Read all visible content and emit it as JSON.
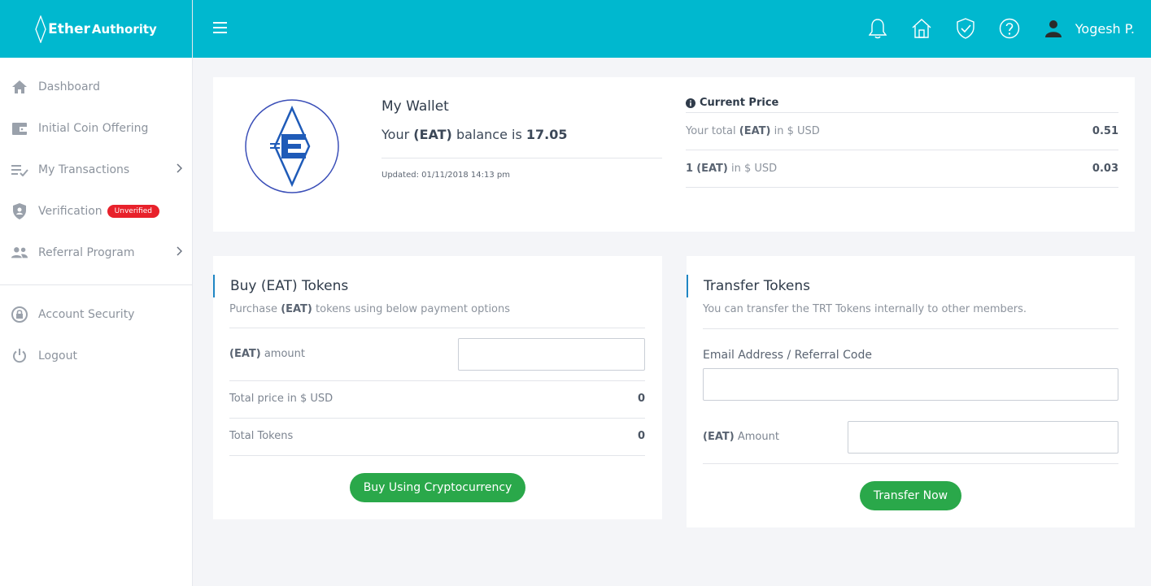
{
  "brand": {
    "name_part1": "Ether",
    "name_part2": "Authority"
  },
  "sidebar": {
    "items": [
      {
        "label": "Dashboard",
        "icon": "home-icon"
      },
      {
        "label": "Initial Coin Offering",
        "icon": "wallet-icon"
      },
      {
        "label": "My Transactions",
        "icon": "transactions-icon",
        "has_submenu": true
      },
      {
        "label": "Verification",
        "icon": "shield-icon",
        "badge": "Unverified"
      },
      {
        "label": "Referral Program",
        "icon": "users-icon",
        "has_submenu": true
      }
    ],
    "secondary": [
      {
        "label": "Account Security",
        "icon": "lock-icon"
      },
      {
        "label": "Logout",
        "icon": "power-icon"
      }
    ]
  },
  "header": {
    "icons": [
      "bell-icon",
      "home-icon",
      "shield-check-icon",
      "help-icon"
    ],
    "user_name": "Yogesh P."
  },
  "wallet": {
    "title": "My Wallet",
    "balance_prefix": "Your",
    "token": "(EAT)",
    "balance_mid": "balance is",
    "balance": "17.05",
    "updated": "Updated: 01/11/2018 14:13 pm"
  },
  "price": {
    "title": "Current Price",
    "rows": [
      {
        "pre": "Your total",
        "token": "(EAT)",
        "mid": "in",
        "currency": "$ USD",
        "value": "0.51"
      },
      {
        "pre": "1",
        "token": "(EAT)",
        "mid": "in",
        "currency": "$ USD",
        "value": "0.03"
      }
    ]
  },
  "buy": {
    "title": "Buy (EAT) Tokens",
    "sub_pre": "Purchase",
    "sub_token": "(EAT)",
    "sub_post": "tokens using below payment options",
    "amount_token": "(EAT)",
    "amount_label": "amount",
    "amount_value": "",
    "total_price_label": "Total price in",
    "total_price_currency": "$ USD",
    "total_price_value": "0",
    "total_tokens_label": "Total Tokens",
    "total_tokens_value": "0",
    "button": "Buy Using Cryptocurrency"
  },
  "transfer": {
    "title": "Transfer Tokens",
    "sub": "You can transfer the TRT Tokens internally to other members.",
    "email_label": "Email Address / Referral Code",
    "email_value": "",
    "amount_token": "(EAT)",
    "amount_label": "Amount",
    "amount_value": "",
    "button": "Transfer Now"
  },
  "colors": {
    "accent": "#00b8cf",
    "button": "#2aa84a",
    "badge": "#e8212b",
    "title_bar": "#1f86c4"
  }
}
